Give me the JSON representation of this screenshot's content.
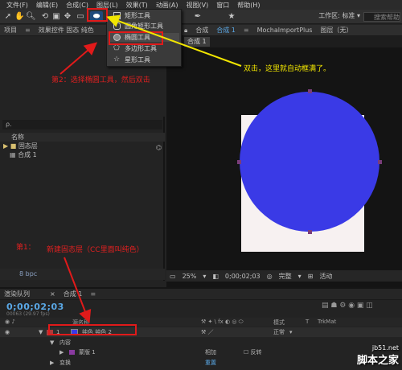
{
  "menubar": [
    "文件(F)",
    "编辑(E)",
    "合成(C)",
    "图层(L)",
    "效果(T)",
    "动画(A)",
    "视图(V)",
    "窗口",
    "帮助(H)"
  ],
  "toolbar": {
    "workspace": "工作区:",
    "workspace_value": "标准",
    "search_placeholder": "搜索帮助"
  },
  "shape_menu": [
    "矩形工具",
    "圆角矩形工具",
    "椭圆工具",
    "多边形工具",
    "星形工具"
  ],
  "project_panel": {
    "tabs": [
      "项目",
      "效果控件 固态 纯色"
    ],
    "search_placeholder": "ρ.",
    "column_name": "名称",
    "items": [
      "固态层",
      "合成 1"
    ],
    "bpc": "8 bpc"
  },
  "comp_panel": {
    "tabs": [
      "合成",
      "合成 1",
      "MochalmportPlus",
      "图层（无）"
    ],
    "breadcrumb": "合成 1",
    "footer": {
      "zoom": "25%",
      "timecode": "0;00;02;03",
      "quality": "完整",
      "view": "活动"
    }
  },
  "timeline": {
    "tabs": [
      "渲染队列",
      "合成 1"
    ],
    "timecode": "0;00;02;03",
    "fps": "00063 (29.97 fps)",
    "col_layer_name": "源名称",
    "col_mode": "模式",
    "col_t": "T",
    "col_trkmat": "TrkMat",
    "layer": {
      "number": "1",
      "name": "纯色 纯色 2",
      "mode": "正常"
    },
    "contents_label": "内容",
    "mask_label": "蒙版 1",
    "mask_mode": "相加",
    "mask_invert": "反转",
    "transform_label": "变换",
    "transform_reset": "重置"
  },
  "annotations": {
    "step2": "第2：选择椭圆工具，然后双击",
    "double_click": "双击，这里就自动框满了。",
    "step1": "第1：",
    "new_solid": "新建固态层（CC里面叫纯色）"
  },
  "watermark": {
    "url": "jb51.net",
    "site": "脚本之家"
  },
  "colors": {
    "ellipse_fill": "#3a3ae6",
    "annotation_red": "#e11a1a",
    "annotation_yellow": "#f2e600",
    "timecode_blue": "#5aa8e6"
  }
}
